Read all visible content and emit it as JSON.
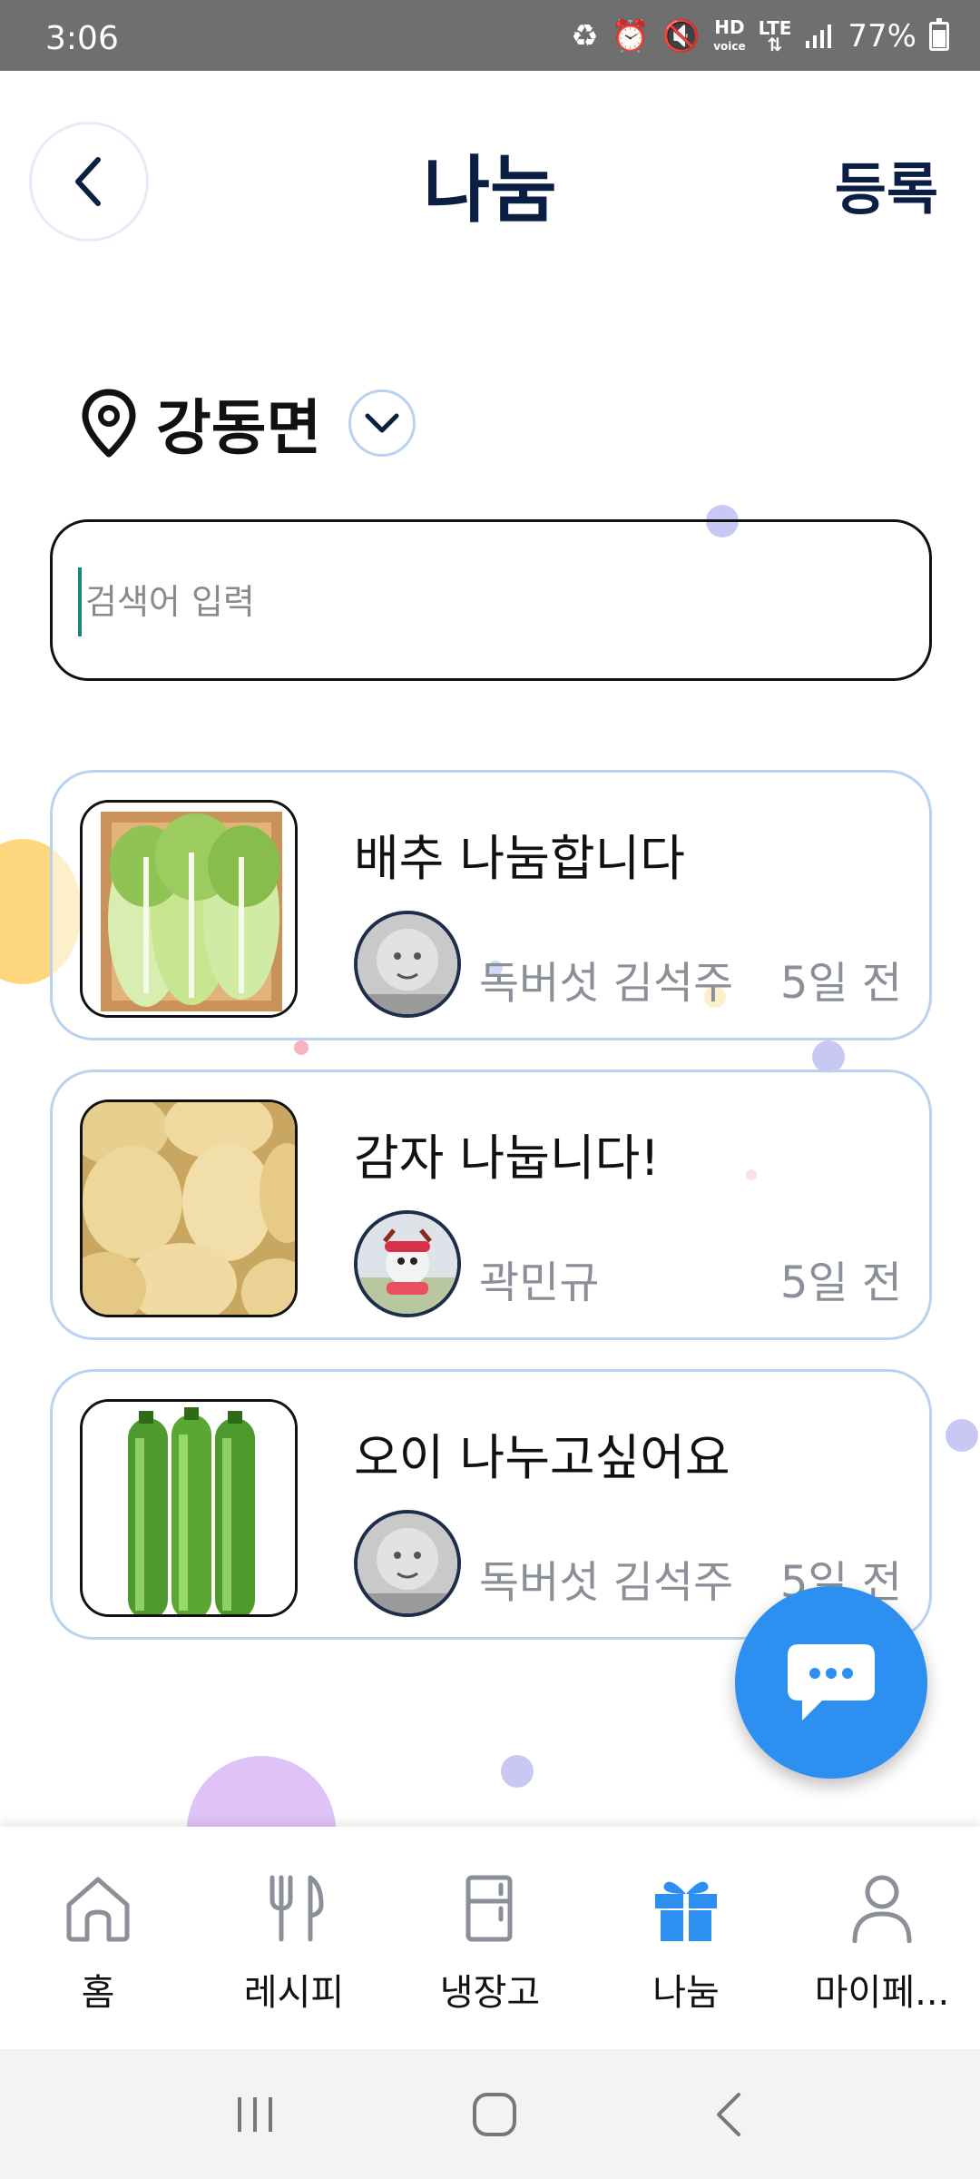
{
  "status_bar": {
    "time": "3:06",
    "battery": "77%",
    "hd_label": "HD",
    "voice_label": "voice",
    "lte_label": "LTE"
  },
  "header": {
    "title": "나눔",
    "register_label": "등록"
  },
  "location": {
    "name": "강동면"
  },
  "search": {
    "placeholder": "검색어 입력",
    "value": ""
  },
  "posts": [
    {
      "title": "배추 나눔합니다",
      "author": "독버섯 김석주",
      "time": "5일 전",
      "image": "napa-cabbage"
    },
    {
      "title": "감자 나눕니다!",
      "author": "곽민규",
      "time": "5일 전",
      "image": "potatoes"
    },
    {
      "title": "오이 나누고싶어요",
      "author": "독버섯 김석주",
      "time": "5일 전",
      "image": "cucumbers"
    }
  ],
  "bottom_nav": [
    {
      "label": "홈",
      "icon": "home-icon"
    },
    {
      "label": "레시피",
      "icon": "fork-knife-icon"
    },
    {
      "label": "냉장고",
      "icon": "fridge-icon"
    },
    {
      "label": "나눔",
      "icon": "gift-icon",
      "active": true
    },
    {
      "label": "마이페...",
      "icon": "person-icon"
    }
  ],
  "colors": {
    "accent": "#2d8ff0",
    "title": "#0b1f44",
    "card_border": "#b9d2f0",
    "muted": "#8a8f98"
  }
}
